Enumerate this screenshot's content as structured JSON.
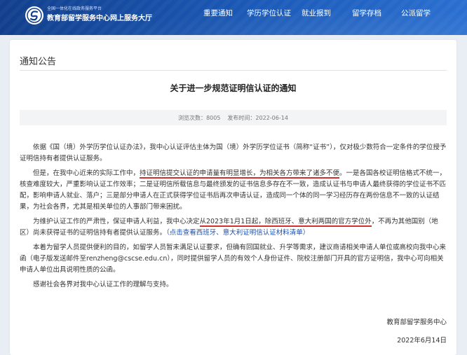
{
  "header": {
    "brand_small": "全国一体化在线政务服务平台",
    "brand_main": "教育部留学服务中心网上服务大厅",
    "nav": [
      "重要通知",
      "学历学位认证",
      "就业报到",
      "留学存档",
      "公派留学"
    ]
  },
  "notice": {
    "section_title": "通知公告",
    "title": "关于进一步规范证明信认证的通知",
    "views_label": "浏览次数：",
    "views": "8005",
    "published_label": "发布时间：",
    "published": "2022-06-14",
    "p1": "依据《国（境）外学历学位认证办法》，我中心认证评估主体为国（境）外学历学位证书（简称“证书”），仅对极少数符合一定条件的学位授予证明信持有者提供认证服务。",
    "p2_a": "但是，在我中心近来的实际工作中，",
    "p2_hl": "持证明信提交认证的申请量有明显增长，为相关各方带来了诸多不便",
    "p2_b": "。一是各国各校证明信格式不统一，核查难度较大，严重影响认证工作效率；二是证明信所载信息与最终颁发的证书信息多存在不一致，造成认证书与申请人最终获得的学位证书不匹配，影响申请人就业、落户；三是部分申请人在正式获得学位证书后再次申请认证，造成同一个体的同一学习经历存在两份信息不一致的认证结果，为社会各界，尤其是相关单位的人事部门带来困扰。",
    "p3_a": "为维护认证工作的严肃性，保证申请人利益，我中心决定",
    "p3_hl": "从2023年1月1日起，除西班牙、意大利两国的官方学位外",
    "p3_b": "，不再为其他国别（地区）尚未获得证书的证明信持有者提供认证服务。",
    "p3_link": "（点击查看西班牙、意大利证明信认证材料清单）",
    "p4": "本着为留学人员提供便利的目的，如留学人员暂未满足认证要求，但确有回国就业、升学等需求，建议商请相关申请人单位或高校向我中心来函（电子版发送邮件至renzheng@cscse.edu.cn），同时提供留学人员的有效个人身份证件、院校注册部门开具的官方证明信，我中心可向相关申请人单位出具说明性质的公函。",
    "p5": "感谢社会各界对我中心认证工作的理解与支持。",
    "signature": "教育部留学服务中心",
    "date": "2022年6月14日"
  },
  "colors": {
    "header_blue": "#1b5ab8",
    "highlight_red": "#d32f2f",
    "link_blue": "#1d4fa8"
  }
}
